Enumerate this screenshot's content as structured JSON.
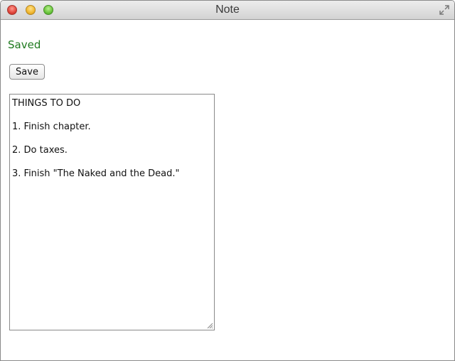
{
  "window": {
    "title": "Note"
  },
  "status": {
    "text": "Saved",
    "color": "#1f7a1f"
  },
  "toolbar": {
    "save_label": "Save"
  },
  "note": {
    "lines": [
      "THINGS TO DO",
      "1. Finish chapter.",
      "2. Do taxes.",
      "3. Finish \"The Naked and the Dead.\""
    ]
  }
}
